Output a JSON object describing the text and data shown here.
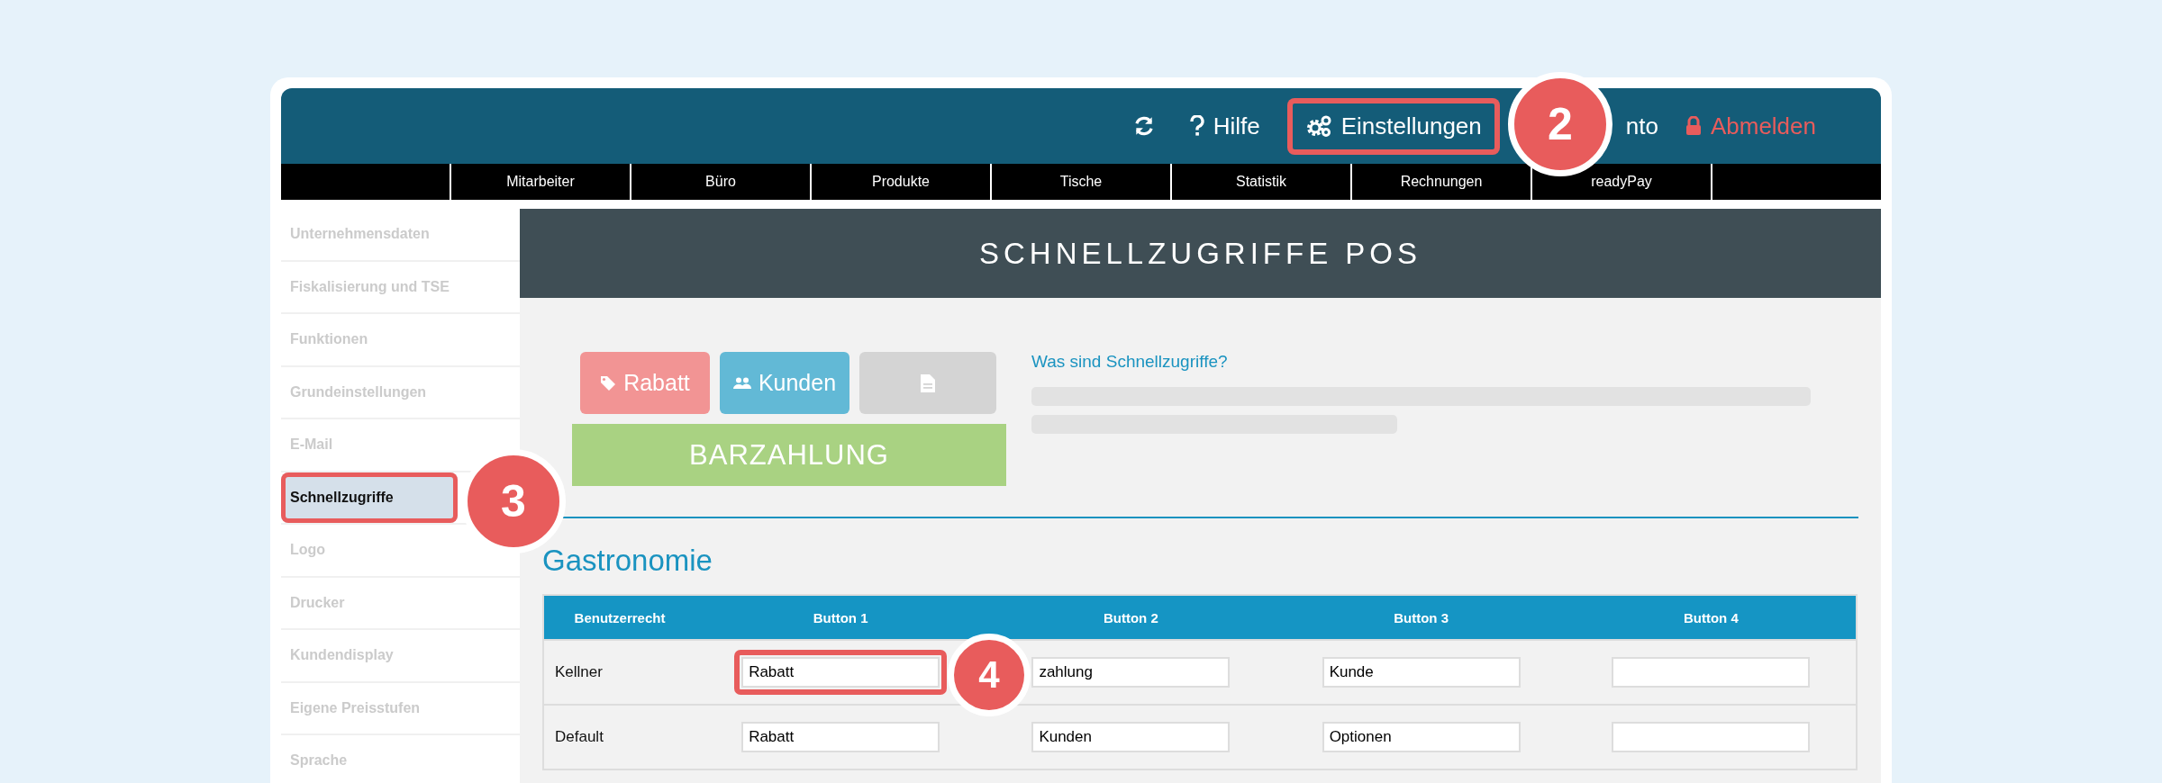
{
  "topbar": {
    "items": [
      {
        "kind": "refresh"
      },
      {
        "kind": "help",
        "label": "Hilfe",
        "highlighted": false
      },
      {
        "kind": "settings",
        "label": "Einstellungen",
        "highlighted": true
      },
      {
        "kind": "plain",
        "label": "nto",
        "highlighted": false
      },
      {
        "kind": "logout",
        "label": "Abmelden",
        "highlighted": false
      }
    ]
  },
  "nav": [
    "Mitarbeiter",
    "Büro",
    "Produkte",
    "Tische",
    "Statistik",
    "Rechnungen",
    "readyPay"
  ],
  "sidebar": {
    "items": [
      {
        "label": "Unternehmensdaten",
        "selected": false,
        "highlighted": false
      },
      {
        "label": "Fiskalisierung und TSE",
        "selected": false,
        "highlighted": false
      },
      {
        "label": "Funktionen",
        "selected": false,
        "highlighted": false
      },
      {
        "label": "Grundeinstellungen",
        "selected": false,
        "highlighted": false
      },
      {
        "label": "E-Mail",
        "selected": false,
        "highlighted": false
      },
      {
        "label": "Schnellzugriffe",
        "selected": true,
        "highlighted": true
      },
      {
        "label": "Logo",
        "selected": false,
        "highlighted": false
      },
      {
        "label": "Drucker",
        "selected": false,
        "highlighted": false
      },
      {
        "label": "Kundendisplay",
        "selected": false,
        "highlighted": false
      },
      {
        "label": "Eigene Preisstufen",
        "selected": false,
        "highlighted": false
      },
      {
        "label": "Sprache",
        "selected": false,
        "highlighted": false
      }
    ]
  },
  "page_title": "SCHNELLZUGRIFFE POS",
  "preview": {
    "buttons": [
      {
        "kind": "tag",
        "label": "Rabatt",
        "color": "#f29494"
      },
      {
        "kind": "people",
        "label": "Kunden",
        "color": "#62b9d6"
      },
      {
        "kind": "document",
        "color": "#d4d4d4"
      }
    ],
    "main_button": {
      "label": "BARZAHLUNG",
      "color": "#a9d282"
    },
    "help_link": "Was sind Schnellzugriffe?"
  },
  "section_title": "Gastronomie",
  "table": {
    "columns": [
      "Benutzerrecht",
      "Button 1",
      "Button 2",
      "Button 3",
      "Button 4"
    ],
    "rows": [
      {
        "cells": [
          {
            "kind": "text",
            "value": "Kellner"
          },
          {
            "kind": "input",
            "value": "Rabatt",
            "highlighted": true
          },
          {
            "kind": "input",
            "value": "zahlung",
            "highlighted": false
          },
          {
            "kind": "input",
            "value": "Kunde",
            "highlighted": false
          },
          {
            "kind": "input",
            "highlighted": false
          }
        ]
      },
      {
        "cells": [
          {
            "kind": "text",
            "value": "Default"
          },
          {
            "kind": "input",
            "value": "Rabatt",
            "highlighted": false
          },
          {
            "kind": "input",
            "value": "Kunden",
            "highlighted": false
          },
          {
            "kind": "input",
            "value": "Optionen",
            "highlighted": false
          },
          {
            "kind": "input",
            "highlighted": false
          }
        ]
      }
    ]
  },
  "callouts": [
    {
      "number": "2"
    },
    {
      "number": "3"
    },
    {
      "number": "4"
    }
  ]
}
